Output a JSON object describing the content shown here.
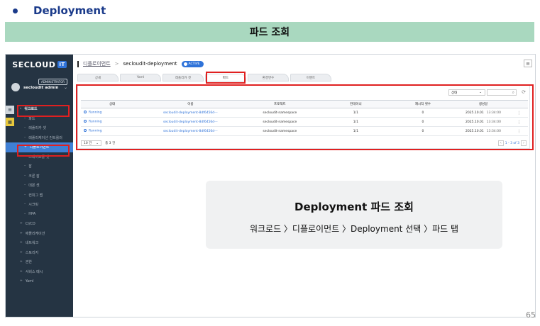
{
  "header": {
    "bullet_title": "Deployment",
    "banner": "파드 조회"
  },
  "app": {
    "logo": "SECLOUD",
    "logo_badge": "IT",
    "admin_badge": "ADMINISTRATOR",
    "user_name": "secloudit admin"
  },
  "sidebar": {
    "items": [
      {
        "label": "워크로드",
        "type": "group",
        "mark": "–"
      },
      {
        "label": "파드",
        "type": "sub",
        "mark": "–"
      },
      {
        "label": "레플리카 셋",
        "type": "sub",
        "mark": "–"
      },
      {
        "label": "레플리케이션 컨트롤러",
        "type": "sub",
        "mark": "–"
      },
      {
        "label": "디플로이먼트",
        "type": "active",
        "mark": "+"
      },
      {
        "label": "스테이트풀 셋",
        "type": "sub",
        "mark": "–"
      },
      {
        "label": "잡",
        "type": "sub",
        "mark": "–"
      },
      {
        "label": "크론 잡",
        "type": "sub",
        "mark": "–"
      },
      {
        "label": "데몬 셋",
        "type": "sub",
        "mark": "–"
      },
      {
        "label": "컨피그 맵",
        "type": "sub",
        "mark": "–"
      },
      {
        "label": "시크릿",
        "type": "sub",
        "mark": "–"
      },
      {
        "label": "HPA",
        "type": "sub",
        "mark": "–"
      },
      {
        "label": "CI/CD",
        "type": "top",
        "mark": "+"
      },
      {
        "label": "애플리케이션",
        "type": "top",
        "mark": "+"
      },
      {
        "label": "네트워크",
        "type": "top",
        "mark": "+"
      },
      {
        "label": "스토리지",
        "type": "top",
        "mark": "+"
      },
      {
        "label": "권한",
        "type": "top",
        "mark": "+"
      },
      {
        "label": "서비스 메시",
        "type": "top",
        "mark": "+"
      },
      {
        "label": "Yaml",
        "type": "top",
        "mark": "+"
      }
    ]
  },
  "breadcrumb": {
    "parent": "디플로이먼트",
    "current": "secloudit-deployment",
    "status": "ACTIVE"
  },
  "tabs": [
    "상세",
    "Yaml",
    "레플리카 셋",
    "파드",
    "환경변수",
    "이벤트"
  ],
  "filter": {
    "select_value": "상태",
    "search_icon": "search-icon",
    "refresh_icon": "refresh-icon"
  },
  "table": {
    "columns": [
      "상태",
      "이름",
      "프로젝트",
      "컨테이너",
      "재시작 횟수",
      "생성일"
    ],
    "rows": [
      {
        "status": "Running",
        "name": "secloudit-deployment-8df6456d-··",
        "project": "secloudit-namespace",
        "containers": "1/1",
        "restarts": "0",
        "date": "2025.10.01",
        "time": "13:34:00"
      },
      {
        "status": "Running",
        "name": "secloudit-deployment-8df6456d-··",
        "project": "secloudit-namespace",
        "containers": "1/1",
        "restarts": "0",
        "date": "2025.10.01",
        "time": "13:34:00"
      },
      {
        "status": "Running",
        "name": "secloudit-deployment-8df6456d-··",
        "project": "secloudit-namespace",
        "containers": "1/1",
        "restarts": "0",
        "date": "2025.10.01",
        "time": "13:34:00"
      }
    ]
  },
  "pagination": {
    "page_size": "10 건",
    "total": "총 3 건",
    "range": "1 - 3 of 3"
  },
  "callout": {
    "title": "Deployment 파드 조회",
    "path": "워크로드 〉디플로이먼트 〉Deployment 선택 〉파드 탭"
  },
  "page_number": "65",
  "colors": {
    "sidebar_bg": "#253443",
    "accent": "#2f73d9",
    "highlight": "#e02020",
    "banner": "#a9d8bf"
  }
}
